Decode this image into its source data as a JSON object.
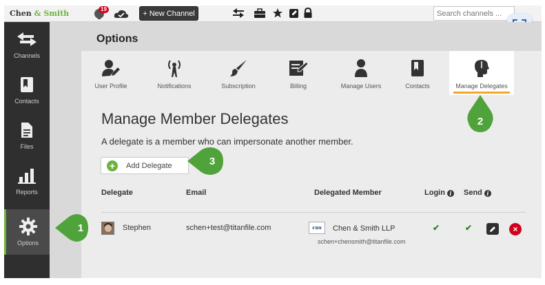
{
  "app": {
    "brand_primary": "Chen",
    "brand_amp": " & ",
    "brand_secondary": "Smith",
    "notification_count": "19",
    "new_channel_label": "+ New Channel",
    "search_placeholder": "Search channels ..."
  },
  "colors": {
    "accent_green": "#6cb33e",
    "active_tab_underline": "#f5a623",
    "sidebar_bg": "#2f2f2f",
    "delete_red": "#d0021b"
  },
  "top_icons": [
    "notifications-icon",
    "cloud-check-icon",
    "transfer-arrows-icon",
    "briefcase-icon",
    "star-icon",
    "edit-icon",
    "lock-icon"
  ],
  "sidebar": {
    "items": [
      {
        "label": "Channels",
        "icon": "channels-arrows-icon"
      },
      {
        "label": "Contacts",
        "icon": "contacts-book-icon"
      },
      {
        "label": "Files",
        "icon": "file-icon"
      },
      {
        "label": "Reports",
        "icon": "bar-chart-icon"
      },
      {
        "label": "Options",
        "icon": "gear-icon",
        "active": true
      }
    ]
  },
  "page": {
    "title": "Options",
    "tabs": [
      {
        "label": "User Profile",
        "icon": "user-edit-icon"
      },
      {
        "label": "Notifications",
        "icon": "broadcast-icon"
      },
      {
        "label": "Subscription",
        "icon": "brush-icon"
      },
      {
        "label": "Billing",
        "icon": "invoice-icon"
      },
      {
        "label": "Manage Users",
        "icon": "users-icon"
      },
      {
        "label": "Contacts",
        "icon": "contacts-book-icon"
      },
      {
        "label": "Manage Delegates",
        "icon": "delegate-head-icon",
        "active": true
      }
    ],
    "heading": "Manage Member Delegates",
    "description": "A delegate is a member who can impersonate another member.",
    "add_delegate_label": "Add Delegate"
  },
  "table": {
    "headers": {
      "delegate": "Delegate",
      "email": "Email",
      "delegated_member": "Delegated Member",
      "login": "Login",
      "send": "Send"
    },
    "rows": [
      {
        "delegate": "Stephen",
        "email": "schen+test@titanfile.com",
        "member_logo": "cus",
        "member_name": "Chen & Smith LLP",
        "member_email": "schen+chensmith@titanfile.com",
        "login": "✔",
        "send": "✔"
      }
    ]
  },
  "callouts": [
    "1",
    "2",
    "3"
  ]
}
